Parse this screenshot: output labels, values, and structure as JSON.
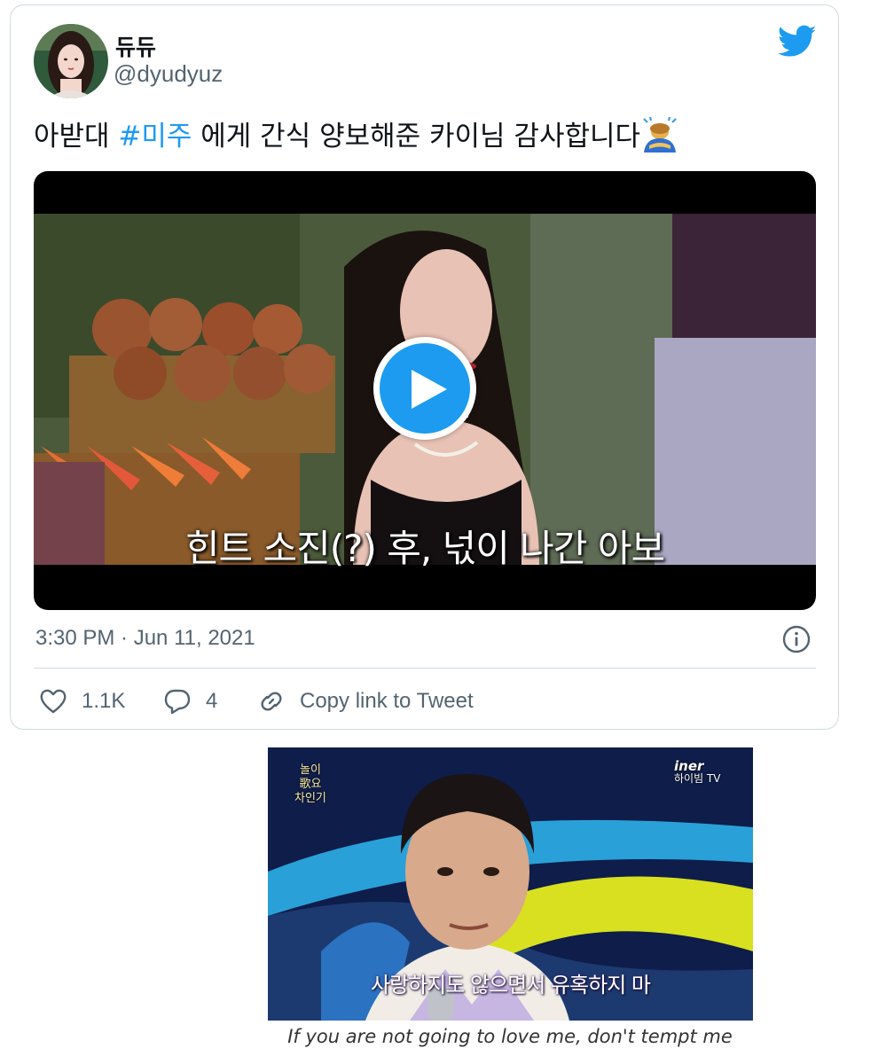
{
  "tweet": {
    "display_name": "듀듀",
    "handle": "@dyudyuz",
    "text_before": "아받대 ",
    "hashtag": "#미주",
    "text_after": " 에게 간식 양보해준 카이님 감사합니다",
    "emoji": "person-bowing-emoji",
    "timestamp": "3:30 PM · Jun 11, 2021",
    "video": {
      "subtitle": "힌트 소진(?) 후,  넋이 나간 아보"
    },
    "actions": {
      "like_count": "1.1K",
      "reply_count": "4",
      "copy_link_label": "Copy link to Tweet"
    },
    "icons": {
      "logo": "twitter-bird-icon",
      "info": "info-icon",
      "like": "heart-icon",
      "reply": "reply-bubble-icon",
      "link": "link-icon",
      "play": "play-icon"
    },
    "colors": {
      "accent": "#1d9bf0",
      "secondary_text": "#536471",
      "border": "#cfd9de"
    }
  },
  "meme": {
    "subtitle": "사랑하지도 않으면서 유혹하지 마",
    "logo_left_line1": "놀이",
    "logo_left_line2": "歌요",
    "logo_left_line3": "차인기",
    "logo_right_line1": "iner",
    "logo_right_line2": "하이빔 TV",
    "caption": "If you are not going to love me, don't tempt me"
  }
}
